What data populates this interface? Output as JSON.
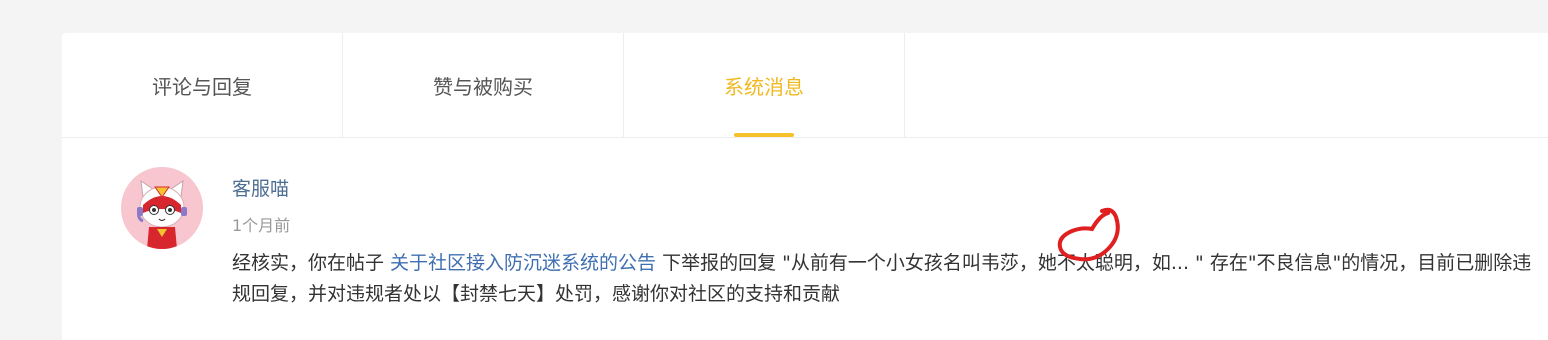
{
  "tabs": [
    {
      "label": "评论与回复",
      "active": false
    },
    {
      "label": "赞与被购买",
      "active": false
    },
    {
      "label": "系统消息",
      "active": true
    }
  ],
  "message": {
    "sender": "客服喵",
    "time": "1个月前",
    "text_before_link": "经核实，你在帖子 ",
    "link_text": "关于社区接入防沉迷系统的公告",
    "text_after_link": " 下举报的回复 \"从前有一个小女孩名叫韦莎，她不太聪明，如...  \" 存在\"不良信息\"的情况，目前已删除违规回复，并对违规者处以【封禁七天】处罚，感谢你对社区的支持和贡献"
  },
  "colors": {
    "accent": "#f0b921",
    "link": "#3f6fb0",
    "annotation": "#e02020"
  }
}
